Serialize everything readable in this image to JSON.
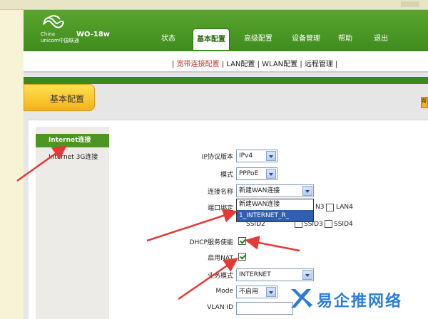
{
  "brand": {
    "line1": "China",
    "line2": "unicom中国联通",
    "model": "WO-18w"
  },
  "tabs": [
    {
      "label": "状态"
    },
    {
      "label": "基本配置"
    },
    {
      "label": "高级配置"
    },
    {
      "label": "设备管理"
    },
    {
      "label": "帮助"
    },
    {
      "label": "退出"
    }
  ],
  "subnav": {
    "prefix": "| ",
    "current": "宽带连接配置",
    "rest": " | LAN配置 | WLAN配置 | 远程管理 |"
  },
  "page_title": "基本配置",
  "side_tag": "帮",
  "leftnav": {
    "active": "Internet连接",
    "item": "Internet 3G连接"
  },
  "form": {
    "ip_version_label": "IP协议版本",
    "ip_version_value": "IPv4",
    "mode_label": "模式",
    "mode_value": "PPPoE",
    "conn_name_label": "连接名称",
    "conn_name_value": "新建WAN连接",
    "dropdown_options": [
      "新建WAN连接",
      "1_INTERNET_R_"
    ],
    "port_bind_label": "端口绑定",
    "lan3_partial": "N3",
    "lan4": "LAN4",
    "ssid2_partial": "SSID2",
    "ssid3": "SSID3",
    "ssid4": "SSID4",
    "dhcp_label": "DHCP服务使能",
    "nat_label": "启用NAT",
    "service_label": "业务模式",
    "service_value": "INTERNET",
    "mode2_label": "Mode",
    "mode2_value": "不启用",
    "vlan_label": "VLAN ID"
  },
  "watermark": {
    "text": "易企推网络"
  },
  "colors": {
    "header_green": "#4a9a25",
    "nav_green": "#4c9621",
    "title_yellow": "#f4b21a",
    "arrow_red": "#e53935",
    "selection_blue": "#2e5fb0"
  }
}
